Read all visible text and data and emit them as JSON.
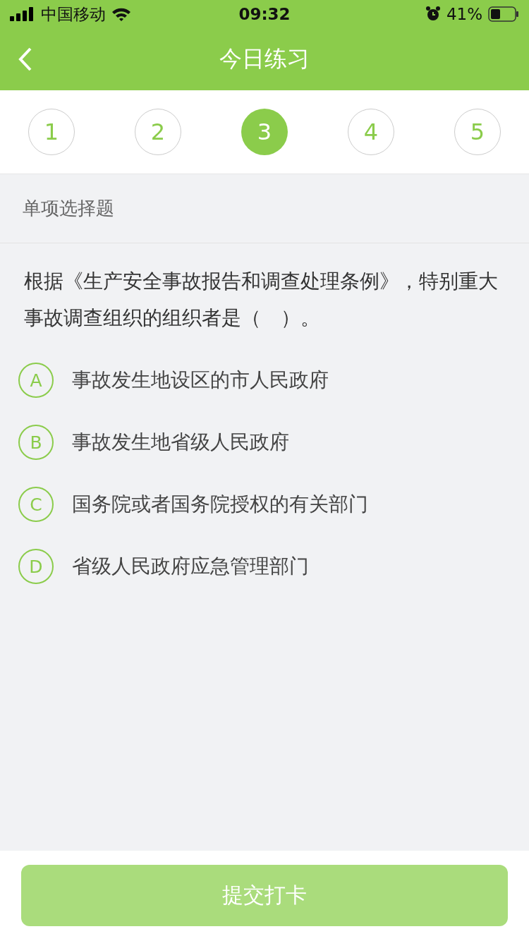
{
  "status_bar": {
    "carrier": "中国移动",
    "time": "09:32",
    "battery": "41%"
  },
  "nav": {
    "title": "今日练习"
  },
  "steps": [
    {
      "label": "1",
      "selected": false
    },
    {
      "label": "2",
      "selected": false
    },
    {
      "label": "3",
      "selected": true
    },
    {
      "label": "4",
      "selected": false
    },
    {
      "label": "5",
      "selected": false
    }
  ],
  "question_type": "单项选择题",
  "question": "根据《生产安全事故报告和调查处理条例》，特别重大事故调查组织的组织者是（　）。",
  "options": [
    {
      "letter": "A",
      "text": "事故发生地设区的市人民政府",
      "selected": false
    },
    {
      "letter": "B",
      "text": "事故发生地省级人民政府",
      "selected": false
    },
    {
      "letter": "C",
      "text": "国务院或者国务院授权的有关部门",
      "selected": false
    },
    {
      "letter": "D",
      "text": "省级人民政府应急管理部门",
      "selected": false
    }
  ],
  "submit": {
    "label": "提交打卡",
    "disabled": true
  }
}
